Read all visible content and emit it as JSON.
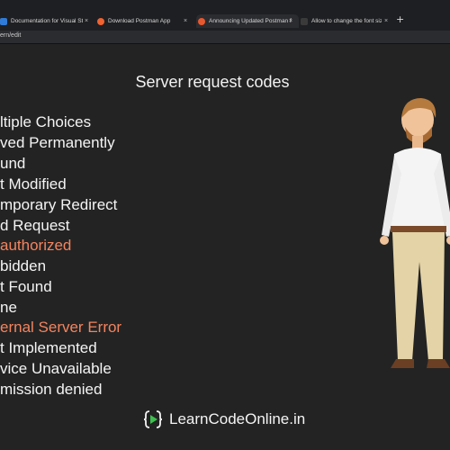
{
  "browser": {
    "tabs": [
      {
        "title": "Documentation for Visual Studio",
        "favicon_color": "#2f7bd8",
        "close": "×"
      },
      {
        "title": "Download Postman App",
        "favicon_color": "#f0622f",
        "close": "×"
      },
      {
        "title": "Announcing Updated Postman F",
        "favicon_color": "#e8582f",
        "close": "×"
      },
      {
        "title": "Allow to change the font size and",
        "favicon_color": "#3a3a3a",
        "close": "×"
      }
    ],
    "new_tab": "+",
    "url": "ern/edit"
  },
  "slide": {
    "title": "Server request codes",
    "codes": [
      {
        "text": "ltiple Choices",
        "highlight": false
      },
      {
        "text": "ved Permanently",
        "highlight": false
      },
      {
        "text": "und",
        "highlight": false
      },
      {
        "text": "t Modified",
        "highlight": false
      },
      {
        "text": "mporary Redirect",
        "highlight": false
      },
      {
        "text": "d Request",
        "highlight": false
      },
      {
        "text": "authorized",
        "highlight": true
      },
      {
        "text": "bidden",
        "highlight": false
      },
      {
        "text": "t Found",
        "highlight": false
      },
      {
        "text": "ne",
        "highlight": false
      },
      {
        "text": "ernal Server Error",
        "highlight": true
      },
      {
        "text": "t Implemented",
        "highlight": false
      },
      {
        "text": "vice Unavailable",
        "highlight": false
      },
      {
        "text": "mission denied",
        "highlight": false
      }
    ],
    "highlight_color": "#f3845f",
    "brand": "LearnCodeOnline.in",
    "brand_icon": "curly-braces-play-icon"
  }
}
